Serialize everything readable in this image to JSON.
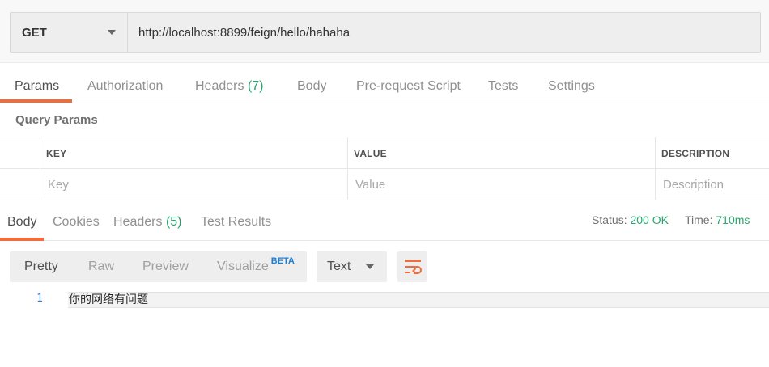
{
  "request": {
    "method": "GET",
    "url": "http://localhost:8899/feign/hello/hahaha"
  },
  "request_tabs": [
    {
      "label": "Params",
      "count": ""
    },
    {
      "label": "Authorization",
      "count": ""
    },
    {
      "label": "Headers",
      "count": "(7)"
    },
    {
      "label": "Body",
      "count": ""
    },
    {
      "label": "Pre-request Script",
      "count": ""
    },
    {
      "label": "Tests",
      "count": ""
    },
    {
      "label": "Settings",
      "count": ""
    }
  ],
  "query_params": {
    "title": "Query Params",
    "columns": [
      "KEY",
      "VALUE",
      "DESCRIPTION"
    ],
    "placeholders": [
      "Key",
      "Value",
      "Description"
    ]
  },
  "response_tabs": [
    {
      "label": "Body",
      "count": ""
    },
    {
      "label": "Cookies",
      "count": ""
    },
    {
      "label": "Headers",
      "count": "(5)"
    },
    {
      "label": "Test Results",
      "count": ""
    }
  ],
  "response_status": {
    "status_label": "Status:",
    "status_value": "200 OK",
    "time_label": "Time:",
    "time_value": "710ms"
  },
  "format_buttons": [
    "Pretty",
    "Raw",
    "Preview",
    "Visualize"
  ],
  "beta_badge": "BETA",
  "language": "Text",
  "response_body": {
    "line_number": "1",
    "line_text": "你的网络有问题"
  },
  "colors": {
    "accent": "#f26b3a",
    "success": "#26a66b",
    "link": "#1e7fd6"
  },
  "icons": [
    "chevron-down-icon",
    "wrap-lines-icon"
  ]
}
